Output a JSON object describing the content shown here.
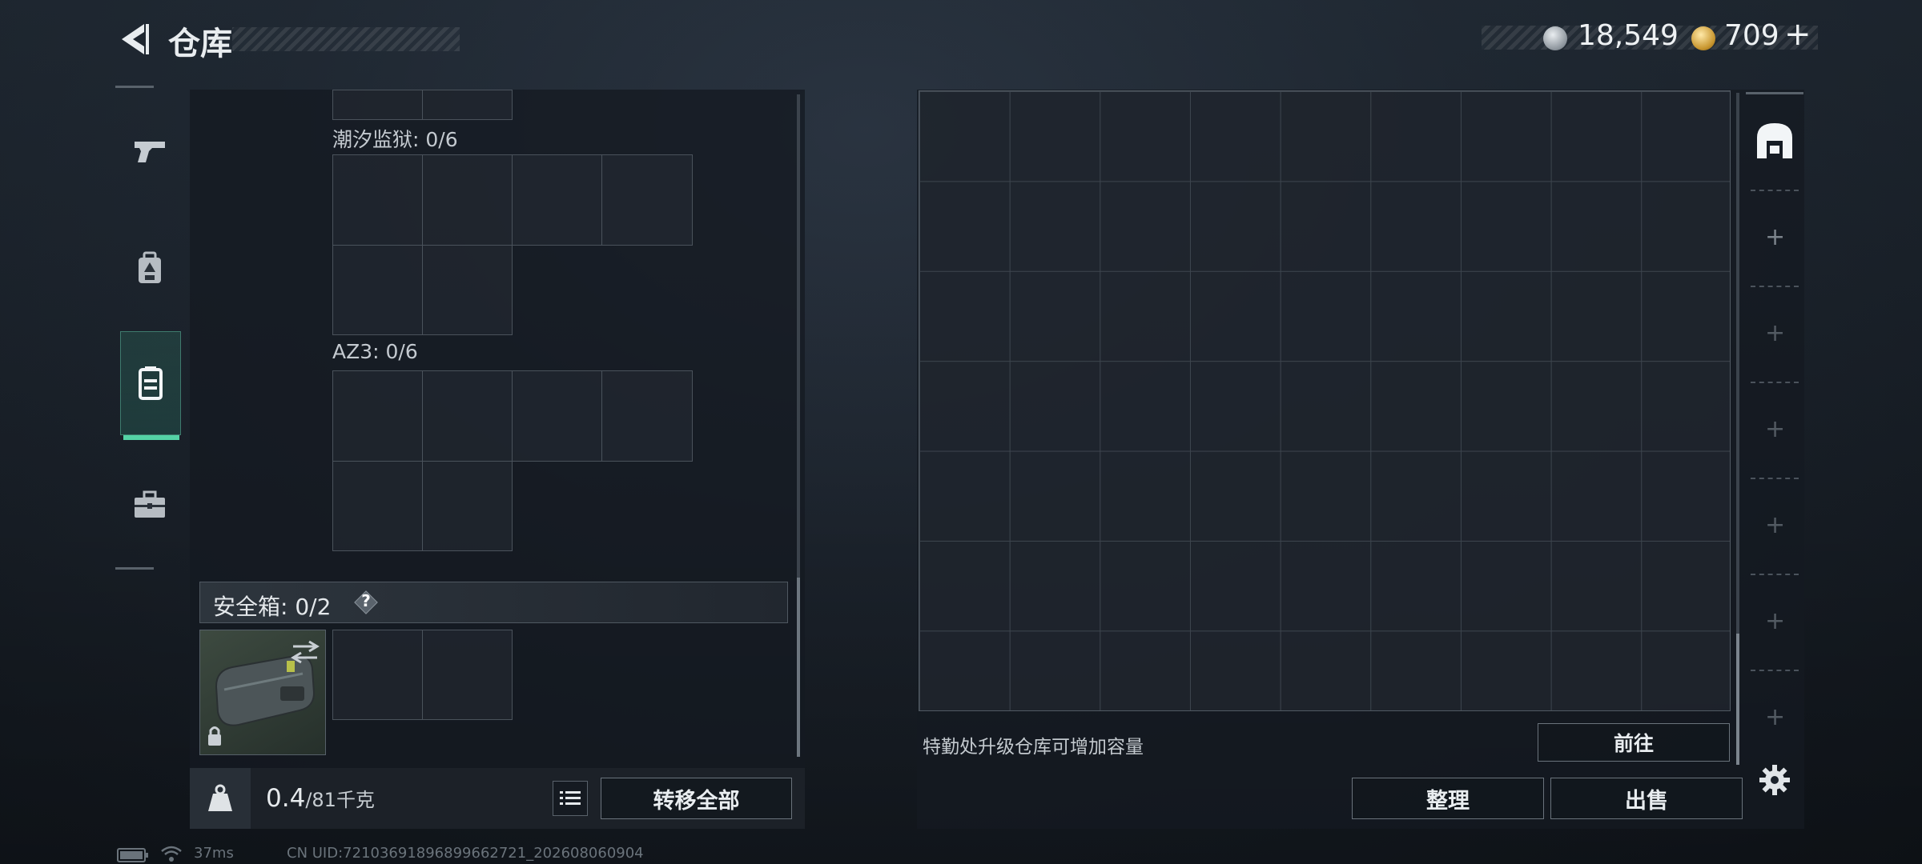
{
  "header": {
    "title": "仓库",
    "silver_value": "18,549",
    "gold_value": "709",
    "gold_plus": "+"
  },
  "left_panel": {
    "section_1_label": "潮汐监狱: 0/6",
    "section_2_label": "AZ3: 0/6",
    "safe_box_label": "安全箱: 0/2",
    "help_label": "?",
    "weight_current": "0.4",
    "weight_max": "/81千克",
    "transfer_all": "转移全部"
  },
  "right_panel": {
    "upgrade_note": "特勤处升级仓库可增加容量",
    "goto_label": "前往",
    "arrange_label": "整理",
    "sell_label": "出售"
  },
  "status": {
    "ping": "37ms",
    "uid": "CN UID:72103691896899662721_202608060904"
  },
  "colors": {
    "accent": "#54d3a6",
    "panel": "#141a21",
    "border": "#4a525b"
  },
  "icons": [
    "back-icon",
    "pistol-icon",
    "backpack-icon",
    "vest-icon",
    "toolbox-icon",
    "storage-icon",
    "silver-coin-icon",
    "gold-coin-icon",
    "kg-weight-icon",
    "list-icon",
    "lock-icon",
    "swap-icon",
    "plus-icon",
    "gear-icon",
    "battery-icon",
    "wifi-icon"
  ]
}
